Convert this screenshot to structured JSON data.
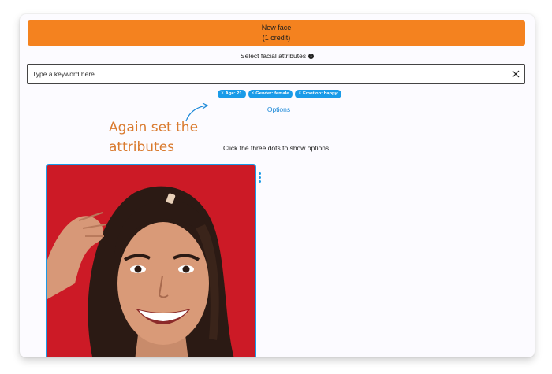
{
  "header": {
    "new_face_label": "New face",
    "credit_label": "(1 credit)"
  },
  "attributes": {
    "label": "Select facial attributes",
    "info_icon": "i",
    "search_placeholder": "Type a keyword here",
    "clear_icon": "close-icon"
  },
  "chips": [
    {
      "x": "×",
      "label": "Age: 21"
    },
    {
      "x": "×",
      "label": "Gender: female"
    },
    {
      "x": "×",
      "label": "Emotion: happy"
    }
  ],
  "options_link": "Options",
  "annotation": {
    "line1": "Again set the",
    "line2": "attributes"
  },
  "hint": "Click the three dots to show options",
  "colors": {
    "accent_orange": "#f4821f",
    "chip_blue": "#1a9be8",
    "annotation_orange": "#d97a2e",
    "photo_background": "#cc1a26"
  }
}
